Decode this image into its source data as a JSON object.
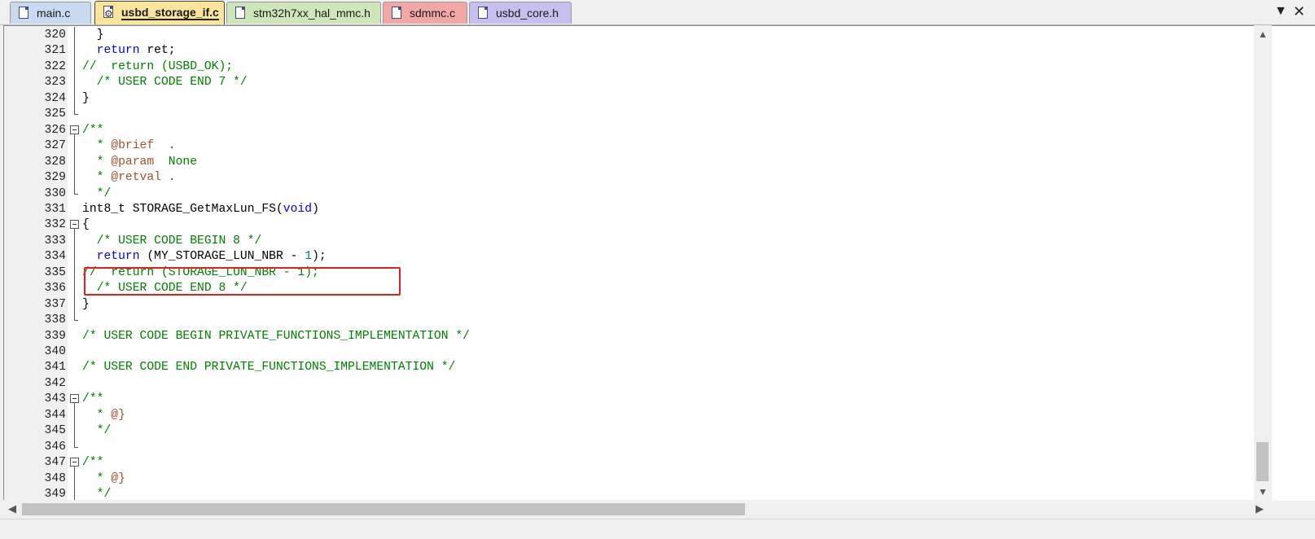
{
  "tabs": [
    {
      "label": "main.c",
      "color": "#c9d9f2",
      "active": false
    },
    {
      "label": "usbd_storage_if.c",
      "color": "#fbe59a",
      "active": true
    },
    {
      "label": "stm32h7xx_hal_mmc.h",
      "color": "#cfe6b8",
      "active": false
    },
    {
      "label": "sdmmc.c",
      "color": "#f2a7a7",
      "active": false
    },
    {
      "label": "usbd_core.h",
      "color": "#c9bfee",
      "active": false
    }
  ],
  "window_controls": {
    "menu_arrow": "▼",
    "close": "✕"
  },
  "editor": {
    "lines": [
      {
        "n": "320",
        "tokens": [
          {
            "t": "  }",
            "c": "#000000"
          }
        ]
      },
      {
        "n": "321",
        "tokens": [
          {
            "t": "  ",
            "c": "#000000"
          },
          {
            "t": "return",
            "c": "#0000ff"
          },
          {
            "t": " ret;",
            "c": "#000000"
          }
        ]
      },
      {
        "n": "322",
        "tokens": [
          {
            "t": "//  return (USBD_OK);",
            "c": "#008000"
          }
        ]
      },
      {
        "n": "323",
        "tokens": [
          {
            "t": "  /* USER CODE END 7 */",
            "c": "#008000"
          }
        ]
      },
      {
        "n": "324",
        "tokens": [
          {
            "t": "}",
            "c": "#000000"
          }
        ]
      },
      {
        "n": "325",
        "tokens": []
      },
      {
        "n": "326",
        "tokens": [
          {
            "t": "/**",
            "c": "#008000"
          }
        ]
      },
      {
        "n": "327",
        "tokens": [
          {
            "t": "  * ",
            "c": "#008000"
          },
          {
            "t": "@brief",
            "c": "#a0522d"
          },
          {
            "t": "  .",
            "c": "#008000"
          }
        ]
      },
      {
        "n": "328",
        "tokens": [
          {
            "t": "  * ",
            "c": "#008000"
          },
          {
            "t": "@param",
            "c": "#a0522d"
          },
          {
            "t": "  None",
            "c": "#008000"
          }
        ]
      },
      {
        "n": "329",
        "tokens": [
          {
            "t": "  * ",
            "c": "#008000"
          },
          {
            "t": "@retval",
            "c": "#a0522d"
          },
          {
            "t": " .",
            "c": "#008000"
          }
        ]
      },
      {
        "n": "330",
        "tokens": [
          {
            "t": "  */",
            "c": "#008000"
          }
        ]
      },
      {
        "n": "331",
        "tokens": [
          {
            "t": "int8_t STORAGE_GetMaxLun_FS(",
            "c": "#000000"
          },
          {
            "t": "void",
            "c": "#0000ff"
          },
          {
            "t": ")",
            "c": "#000000"
          }
        ]
      },
      {
        "n": "332",
        "tokens": [
          {
            "t": "{",
            "c": "#000000"
          }
        ]
      },
      {
        "n": "333",
        "tokens": [
          {
            "t": "  /* USER CODE BEGIN 8 */",
            "c": "#008000"
          }
        ]
      },
      {
        "n": "334",
        "tokens": [
          {
            "t": "  ",
            "c": "#000000"
          },
          {
            "t": "return",
            "c": "#0000ff"
          },
          {
            "t": " (MY_STORAGE_LUN_NBR - ",
            "c": "#000000"
          },
          {
            "t": "1",
            "c": "#008080"
          },
          {
            "t": ");",
            "c": "#000000"
          }
        ]
      },
      {
        "n": "335",
        "tokens": [
          {
            "t": "//  return (STORAGE_LUN_NBR - 1);",
            "c": "#008000"
          }
        ]
      },
      {
        "n": "336",
        "tokens": [
          {
            "t": "  /* USER CODE END 8 */",
            "c": "#008000"
          }
        ]
      },
      {
        "n": "337",
        "tokens": [
          {
            "t": "}",
            "c": "#000000"
          }
        ]
      },
      {
        "n": "338",
        "tokens": []
      },
      {
        "n": "339",
        "tokens": [
          {
            "t": "/* USER CODE BEGIN PRIVATE_FUNCTIONS_IMPLEMENTATION */",
            "c": "#008000"
          }
        ]
      },
      {
        "n": "340",
        "tokens": []
      },
      {
        "n": "341",
        "tokens": [
          {
            "t": "/* USER CODE END PRIVATE_FUNCTIONS_IMPLEMENTATION */",
            "c": "#008000"
          }
        ]
      },
      {
        "n": "342",
        "tokens": []
      },
      {
        "n": "343",
        "tokens": [
          {
            "t": "/**",
            "c": "#008000"
          }
        ]
      },
      {
        "n": "344",
        "tokens": [
          {
            "t": "  * ",
            "c": "#008000"
          },
          {
            "t": "@}",
            "c": "#a0522d"
          }
        ]
      },
      {
        "n": "345",
        "tokens": [
          {
            "t": "  */",
            "c": "#008000"
          }
        ]
      },
      {
        "n": "346",
        "tokens": []
      },
      {
        "n": "347",
        "tokens": [
          {
            "t": "/**",
            "c": "#008000"
          }
        ]
      },
      {
        "n": "348",
        "tokens": [
          {
            "t": "  * ",
            "c": "#008000"
          },
          {
            "t": "@}",
            "c": "#a0522d"
          }
        ]
      },
      {
        "n": "349",
        "tokens": [
          {
            "t": "  */",
            "c": "#008000"
          }
        ]
      }
    ],
    "folds": [
      "line",
      "line",
      "line",
      "line",
      "line",
      "end",
      "box",
      "line",
      "line",
      "line",
      "end",
      "none",
      "box",
      "line",
      "line",
      "line",
      "line",
      "line",
      "end",
      "none",
      "none",
      "none",
      "none",
      "box",
      "line",
      "line",
      "end",
      "box",
      "line",
      "line"
    ]
  },
  "annotation": {
    "color": "#e02020",
    "covers_line": "334"
  }
}
